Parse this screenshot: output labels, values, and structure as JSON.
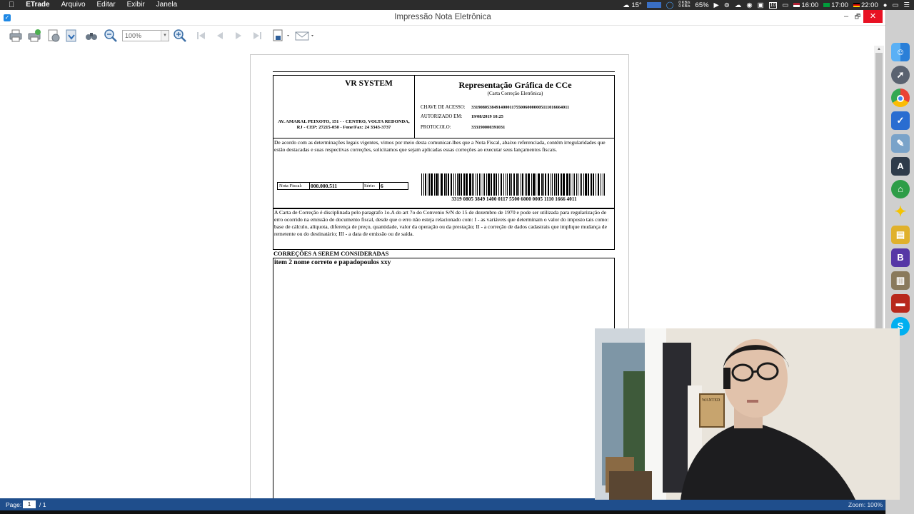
{
  "menubar": {
    "apple": "",
    "app_name": "ETrade",
    "menus": [
      "Arquivo",
      "Editar",
      "Exibir",
      "Janela"
    ],
    "weather": "15°",
    "net_up": "0 KB/s",
    "net_down": "0 KB/s",
    "battery": "65%",
    "notif_count": "10",
    "clock_us": "16:00",
    "clock_br": "17:00",
    "clock_de": "22:00"
  },
  "window": {
    "title": "Impressão Nota Eletrônica",
    "min": "‒",
    "max": "🗗",
    "close": "✕"
  },
  "toolbar": {
    "zoom_value": "100%",
    "zoom_arrow": "▾"
  },
  "document": {
    "company": "VR SYSTEM",
    "address": "AV. AMARAL PEIXOTO, 151 -  - CENTRO, VOLTA REDONDA, RJ - CEP: 27215-050 - Fone/Fax: 24 3343-3737",
    "title": "Representação Gráfica de CCe",
    "subtitle": "(Carta Correção Eletrônica)",
    "chave_label": "CHAVE DE ACESSO:",
    "chave_value": "33190805384914000117550060000005111016664011",
    "autorizado_label": "AUTORIZADO EM:",
    "autorizado_value": "19/08/2019 10:25",
    "protocolo_label": "PROTOCOLO:",
    "protocolo_value": "333190000391031",
    "intro": "De acordo com as determinações legais vigentes, vimos por meio desta comunicar-lhes que a Nota Fiscal, abaixo referenciada, contém irregularidades que estão destacadas e suas respectivas correções, solicitamos que sejam aplicadas essas correções ao executar seus lançamentos fiscais.",
    "nf_label": "Nota Fiscal:",
    "nf_value": "000.000.511",
    "serie_label": "Série:",
    "serie_value": "6",
    "barcode_number": "3319 0805 3849 1400 0117 5500 6000 0005 1110 1666 4011",
    "legal": "A Carta de Correção é disciplinada pelo paragrafo 1o.A do art 7o do Convenio S/N de 15 de dezembro de 1970 e pode ser utilizada para regularização de erro ocorrido na emissão de documento fiscal, desde que o erro não esteja relacionado com: I - as variáveis que determinam o valor do imposto tais como: base de cálculo, alíquota, diferença de preço, quantidade, valor da operação ou da prestação; II - a correção de dados cadastrais que implique mudança de remetente ou do destinatário; III - a data de emissão ou de saída.",
    "corrections_title": "CORREÇÕES A SEREM CONSIDERADAS",
    "corrections_text": "item 2 nome correto e papadopoulos xxy"
  },
  "statusbar": {
    "page_label": "Page:",
    "page_value": "1",
    "page_total": "/ 1",
    "zoom": "Zoom: 100%"
  },
  "webcam_poster": "WANTED",
  "dock": [
    "finder-icon",
    "launchpad-icon",
    "chrome-icon",
    "tasks-icon",
    "preview-icon",
    "affinity-icon",
    "bank-icon",
    "tes-icon",
    "stack-icon",
    "bbedit-icon",
    "notes-icon",
    "photo-booth-icon",
    "skype-icon"
  ],
  "colors": {
    "statusbar": "#1f4e8c",
    "close_button": "#e81123",
    "menubar": "#2c2c2c"
  }
}
